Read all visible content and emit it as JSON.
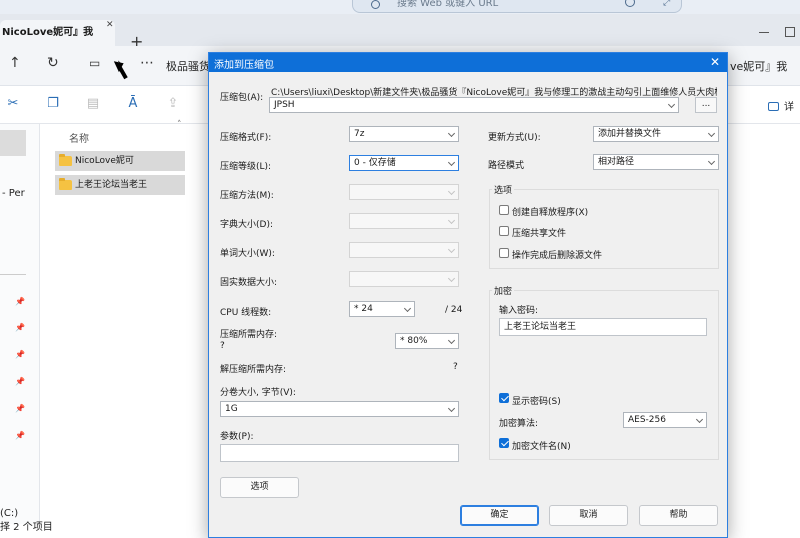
{
  "browser": {
    "search_placeholder": "搜索 Web 或键入 URL",
    "tab_title": "NicoLove妮可』我",
    "new_tab": "+",
    "nav_title": "极品骚货",
    "nav_title_right": "ve妮可』我"
  },
  "toolbar": {
    "details_label": "详"
  },
  "explorer": {
    "sidebar_partial_label": "- Per",
    "column_name": "名称",
    "files": [
      {
        "name": "NicoLove妮可"
      },
      {
        "name": "上老王论坛当老王"
      }
    ],
    "drive_label": "(C:)",
    "status": "择 2 个项目"
  },
  "dialog": {
    "title": "添加到压缩包",
    "archive_label": "压缩包(A):",
    "archive_path": "C:\\Users\\liuxi\\Desktop\\新建文件夹\\极品骚货『NicoLove妮可』我与修理工的激战主动勾引上面维修人员大肉棒修理",
    "archive_name": "JPSH",
    "browse_label": "...",
    "format_label": "压缩格式(F):",
    "format_value": "7z",
    "level_label": "压缩等级(L):",
    "level_value": "0 - 仅存储",
    "method_label": "压缩方法(M):",
    "dict_label": "字典大小(D):",
    "word_label": "单词大小(W):",
    "solid_label": "固实数据大小:",
    "cpu_label": "CPU 线程数:",
    "cpu_value": "* 24",
    "cpu_total": "/ 24",
    "mem_label": "压缩所需内存:",
    "mem_q": "?",
    "mem_value": "* 80%",
    "decomp_label": "解压缩所需内存:",
    "decomp_value": "?",
    "volume_label": "分卷大小, 字节(V):",
    "volume_value": "1G",
    "params_label": "参数(P):",
    "params_value": "",
    "options_button": "选项",
    "update_label": "更新方式(U):",
    "update_value": "添加并替换文件",
    "pathmode_label": "路径模式",
    "pathmode_value": "相对路径",
    "options_group": "选项",
    "opt_sfx": "创建自释放程序(X)",
    "opt_shared": "压缩共享文件",
    "opt_delete": "操作完成后删除源文件",
    "encryption_group": "加密",
    "password_label": "输入密码:",
    "password_value": "上老王论坛当老王",
    "show_password": "显示密码(S)",
    "enc_method_label": "加密算法:",
    "enc_method_value": "AES-256",
    "encrypt_names": "加密文件名(N)",
    "ok": "确定",
    "cancel": "取消",
    "help": "帮助",
    "checkbox_states": {
      "sfx": false,
      "shared": false,
      "delete": false,
      "show_password": true,
      "encrypt_names": true
    }
  }
}
